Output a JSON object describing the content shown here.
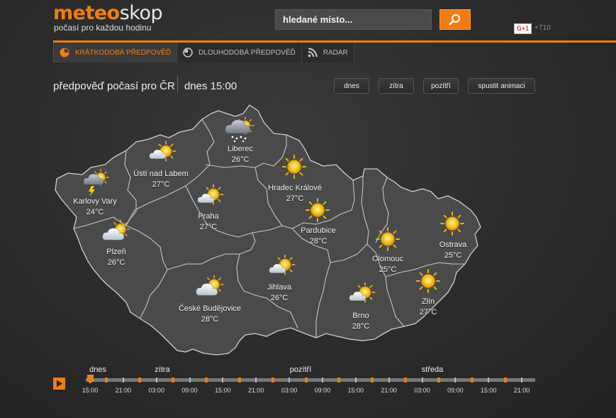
{
  "header": {
    "logo_part1": "meteo",
    "logo_part2": "skop",
    "tagline": "počasí pro každou hodinu",
    "search_placeholder": "hledané místo...",
    "gplus_label": "G+1",
    "gplus_count": "+710"
  },
  "nav": {
    "tabs": [
      {
        "label": "KRÁTKODOBÁ PŘEDPOVĚĎ",
        "active": true,
        "icon": "clock-icon"
      },
      {
        "label": "DLOUHODOBÁ PŘEDPOVĚĎ",
        "active": false,
        "icon": "clock-outline-icon"
      },
      {
        "label": "RADAR",
        "active": false,
        "icon": "rss-icon"
      }
    ]
  },
  "forecast": {
    "title": "předpověď počasí pro ČR",
    "time": "dnes 15:00",
    "buttons": [
      "dnes",
      "zítra",
      "pozítří",
      "spustit animaci"
    ]
  },
  "cities": [
    {
      "name": "Liberec",
      "temp": "26°C",
      "icon": "snow-cloud-icon"
    },
    {
      "name": "Ústí nad Labem",
      "temp": "27°C",
      "icon": "sun-cloud-icon"
    },
    {
      "name": "Karlovy Vary",
      "temp": "24°C",
      "icon": "storm-icon"
    },
    {
      "name": "Hradec Králové",
      "temp": "27°C",
      "icon": "sun-icon"
    },
    {
      "name": "Praha",
      "temp": "27°C",
      "icon": "sun-cloud-icon"
    },
    {
      "name": "Pardubice",
      "temp": "28°C",
      "icon": "sun-icon"
    },
    {
      "name": "Plzeň",
      "temp": "26°C",
      "icon": "cloud-sun-icon"
    },
    {
      "name": "Olomouc",
      "temp": "25°C",
      "icon": "sun-icon"
    },
    {
      "name": "Ostrava",
      "temp": "25°C",
      "icon": "sun-icon"
    },
    {
      "name": "Jihlava",
      "temp": "26°C",
      "icon": "sun-cloud-icon"
    },
    {
      "name": "České Budějovice",
      "temp": "28°C",
      "icon": "cloud-sun-icon"
    },
    {
      "name": "Brno",
      "temp": "28°C",
      "icon": "sun-cloud-icon"
    },
    {
      "name": "Zlín",
      "temp": "27°C",
      "icon": "sun-icon"
    }
  ],
  "timeline": {
    "days": [
      "dnes",
      "zítra",
      "pozítří",
      "středa"
    ],
    "hours": [
      "15:00",
      "21:00",
      "03:00",
      "09:00",
      "15:00",
      "21:00",
      "03:00",
      "09:00",
      "15:00",
      "21:00",
      "03:00",
      "09:00",
      "15:00",
      "21:00"
    ],
    "current": "15:00"
  },
  "colors": {
    "accent": "#f07d12",
    "map_fill": "#4a4a4a",
    "border": "#c8c8c8"
  }
}
